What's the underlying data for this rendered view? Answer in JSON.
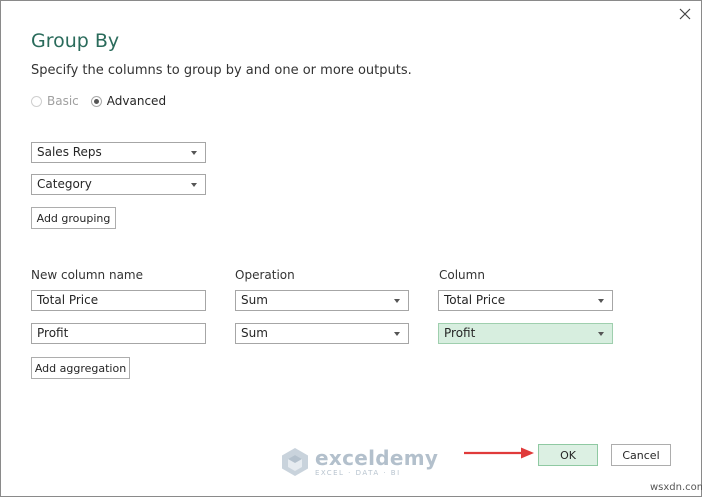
{
  "dialog": {
    "title": "Group By",
    "subtitle": "Specify the columns to group by and one or more outputs."
  },
  "mode": {
    "basic_label": "Basic",
    "advanced_label": "Advanced",
    "selected": "Advanced"
  },
  "grouping": {
    "fields": [
      "Sales Reps",
      "Category"
    ],
    "add_label": "Add grouping"
  },
  "aggregation": {
    "headers": {
      "name": "New column name",
      "operation": "Operation",
      "column": "Column"
    },
    "rows": [
      {
        "name": "Total Price",
        "operation": "Sum",
        "column": "Total Price"
      },
      {
        "name": "Profit",
        "operation": "Sum",
        "column": "Profit"
      }
    ],
    "add_label": "Add aggregation"
  },
  "footer": {
    "ok_label": "OK",
    "cancel_label": "Cancel"
  },
  "watermark": {
    "name": "exceldemy",
    "tagline": "EXCEL · DATA · BI"
  },
  "site_mark": "wsxdn.com",
  "colors": {
    "title": "#2a6b5b",
    "highlight": "#d7eedf",
    "ok_button": "#dcf0e3",
    "arrow": "#e03a3a"
  }
}
